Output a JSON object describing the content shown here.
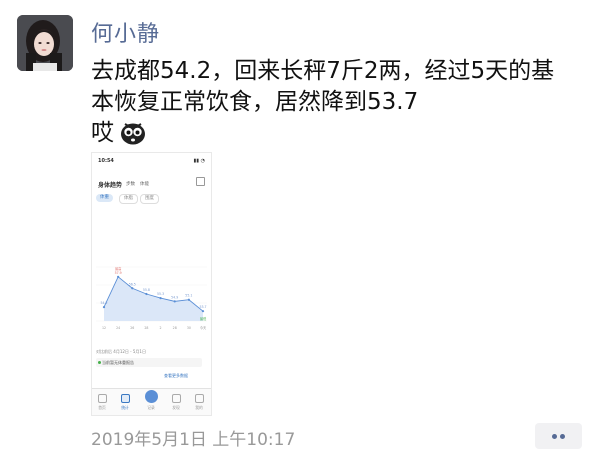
{
  "post": {
    "author": "何小静",
    "text_lines": [
      "去成都54.2，回来长秤7斤2两，经过5天的基",
      "本恢复正常饮食，居然降到53.7",
      "哎"
    ],
    "timestamp": "2019年5月1日 上午10:17"
  },
  "screenshot": {
    "time": "10:54",
    "page_title": "身体趋势",
    "subtabs": [
      "步数",
      "体能"
    ],
    "segments": [
      "体重",
      "体脂",
      "围度"
    ],
    "chart_data": {
      "type": "area",
      "values": [
        54.2,
        57.9,
        56.5,
        55.8,
        55.3,
        54.9,
        55.1,
        53.7
      ],
      "point_labels": [
        "54.2",
        "57.9",
        "56.5",
        "55.8",
        "55.3",
        "54.9",
        "55.1",
        "53.7"
      ],
      "peak_label": "最高",
      "min_label": "最低",
      "x_labels": [
        "12",
        "24",
        "26",
        "28",
        "2",
        "28",
        "30",
        "今天"
      ],
      "accent": "#5b8fd6",
      "fill": "#dbe7f8"
    },
    "range_text": "对比前后 4月12日 - 5月1日",
    "tip": "当前暂无体重报告",
    "link": "查看更多数据",
    "tabs": [
      "首页",
      "统计",
      "记录",
      "发现",
      "我的"
    ]
  },
  "colors": {
    "author": "#576b95",
    "timestamp": "#999999",
    "more_bg": "#f1f1f3"
  }
}
